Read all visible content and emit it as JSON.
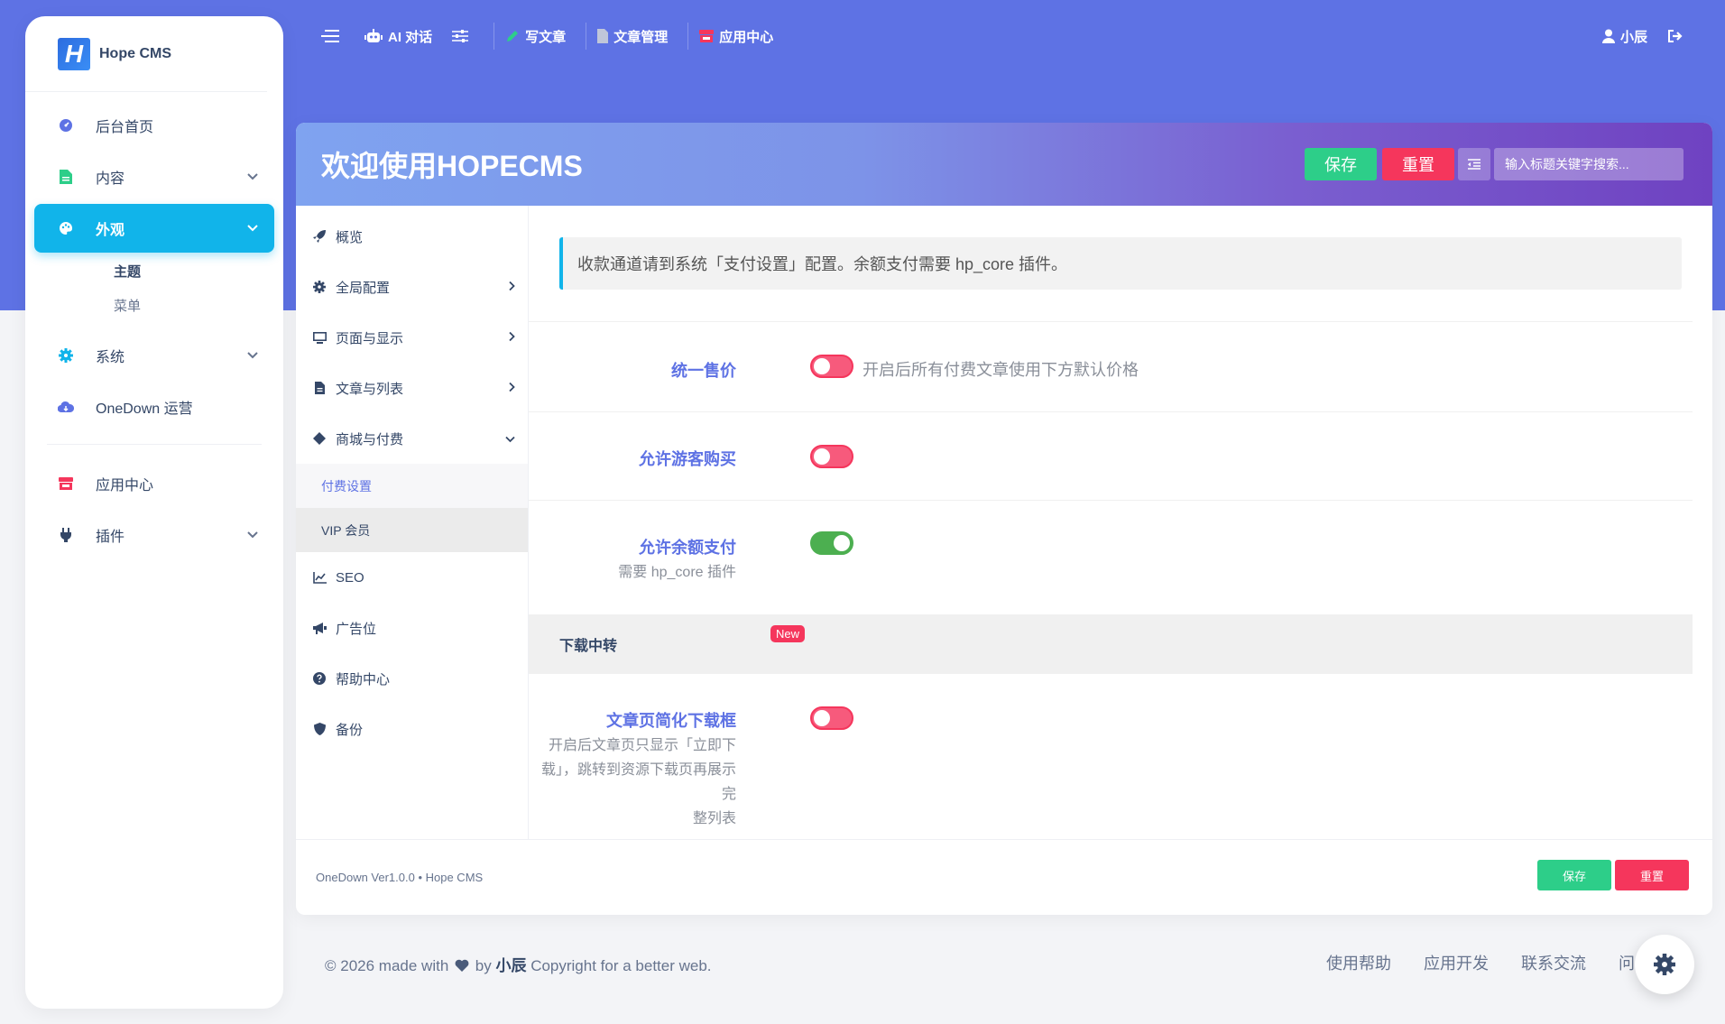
{
  "brand": {
    "name": "Hope CMS",
    "logo_letter": "H"
  },
  "sidebar": {
    "items": [
      {
        "label": "后台首页"
      },
      {
        "label": "内容"
      },
      {
        "label": "外观"
      },
      {
        "label": "系统"
      },
      {
        "label": "OneDown 运营"
      },
      {
        "label": "应用中心"
      },
      {
        "label": "插件"
      }
    ],
    "sub": [
      "主题",
      "菜单"
    ]
  },
  "topbar": {
    "items": [
      "AI 对话",
      "写文章",
      "文章管理",
      "应用中心"
    ],
    "user": "小辰"
  },
  "header": {
    "title": "欢迎使用HOPECMS",
    "save": "保存",
    "reset": "重置",
    "search_placeholder": "输入标题关键字搜索..."
  },
  "menu": {
    "items": [
      "概览",
      "全局配置",
      "页面与显示",
      "文章与列表",
      "商城与付费",
      "SEO",
      "广告位",
      "帮助中心",
      "备份"
    ],
    "sub": [
      "付费设置",
      "VIP 会员"
    ]
  },
  "content": {
    "notice": "收款通道请到系统「支付设置」配置。余额支付需要 hp_core 插件。",
    "rows": [
      {
        "label": "统一售价",
        "note": "开启后所有付费文章使用下方默认价格",
        "on": false
      },
      {
        "label": "允许游客购买",
        "on": false
      },
      {
        "label": "允许余额支付",
        "desc": "需要 hp_core 插件",
        "on": true
      }
    ],
    "section": {
      "title": "下载中转",
      "badge": "New"
    },
    "download_row": {
      "label": "文章页简化下载框",
      "desc_lines": [
        "开启后文章页只显示「立即下",
        "载」，跳转到资源下载页再展示完",
        "整列表"
      ],
      "on": false
    }
  },
  "card_footer": {
    "version": "OneDown Ver1.0.0 • Hope CMS",
    "save": "保存",
    "reset": "重置"
  },
  "page_footer": {
    "prefix": "© 2026 made with",
    "by": "by",
    "author": "小辰",
    "suffix": "Copyright for a better web.",
    "links": [
      "使用帮助",
      "应用开发",
      "联系交流",
      "问"
    ]
  },
  "colors": {
    "primary": "#5e72e4",
    "accent": "#11b4ea",
    "success": "#2dce89",
    "danger": "#f5365c"
  }
}
